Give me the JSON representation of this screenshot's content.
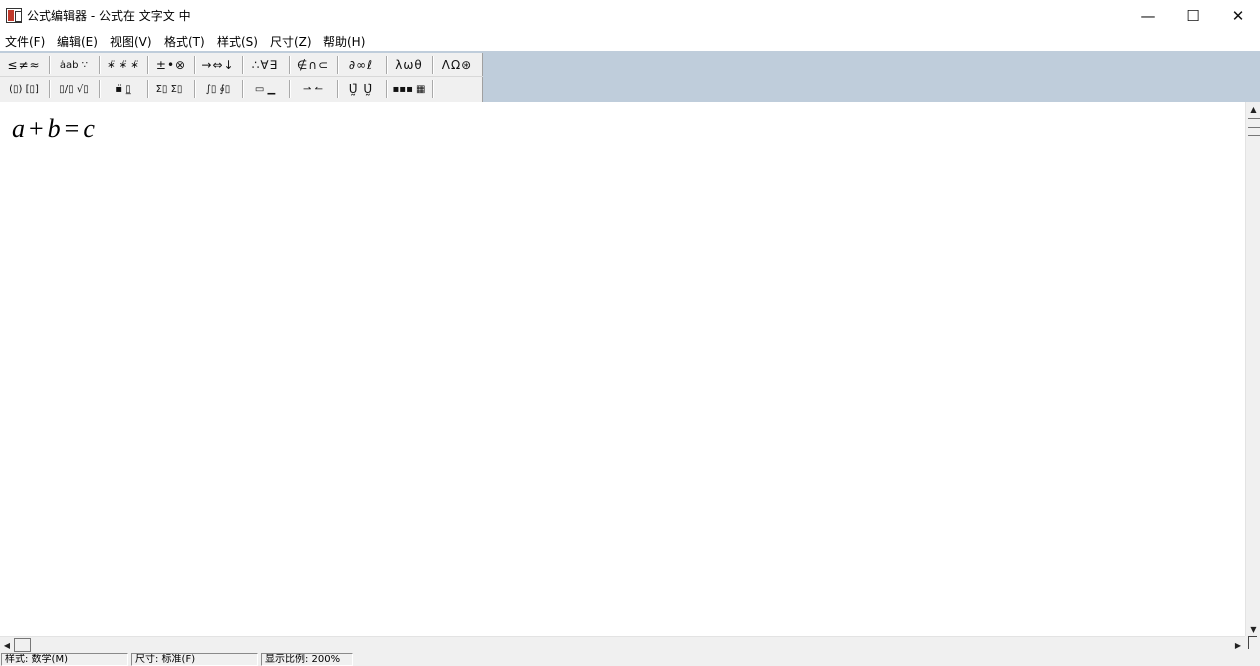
{
  "window": {
    "title": "公式编辑器 - 公式在 文字文 中",
    "minimize_glyph": "—",
    "maximize_glyph": "☐",
    "close_glyph": "✕",
    "icon": "equation-editor-icon"
  },
  "menu": [
    {
      "label": "文件(F)"
    },
    {
      "label": "编辑(E)"
    },
    {
      "label": "视图(V)"
    },
    {
      "label": "格式(T)"
    },
    {
      "label": "样式(S)"
    },
    {
      "label": "尺寸(Z)"
    },
    {
      "label": "帮助(H)"
    }
  ],
  "palette": {
    "row1": [
      {
        "label": "≤≠≈",
        "icon": "relational-symbols-icon"
      },
      {
        "label": "ȧab ∵",
        "icon": "spaces-ellipses-icon"
      },
      {
        "label": "∗̈ ∗̈ ∗̈",
        "icon": "embellishments-icon"
      },
      {
        "label": "±•⊗",
        "icon": "operator-symbols-icon"
      },
      {
        "label": "→⇔↓",
        "icon": "arrow-symbols-icon"
      },
      {
        "label": "∴∀∃",
        "icon": "logical-symbols-icon"
      },
      {
        "label": "∉∩⊂",
        "icon": "set-theory-symbols-icon"
      },
      {
        "label": "∂∞ℓ",
        "icon": "misc-symbols-icon"
      },
      {
        "label": "λωθ",
        "icon": "greek-lowercase-icon"
      },
      {
        "label": "ΛΩ⊛",
        "icon": "greek-uppercase-icon"
      }
    ],
    "row2": [
      {
        "label": "(▯) [▯]",
        "icon": "fence-templates-icon"
      },
      {
        "label": "▯/▯ √▯",
        "icon": "fraction-radical-templates-icon"
      },
      {
        "label": "▪̈ ▯̲",
        "icon": "subscript-superscript-templates-icon"
      },
      {
        "label": "Σ▯ Σ▯",
        "icon": "summation-templates-icon"
      },
      {
        "label": "∫▯ ∮▯",
        "icon": "integral-templates-icon"
      },
      {
        "label": "▭ ▁",
        "icon": "underbar-overbar-templates-icon"
      },
      {
        "label": "⇀ ↼",
        "icon": "labeled-arrow-templates-icon"
      },
      {
        "label": "Ṵ̄ Ṵ̇",
        "icon": "products-set-theory-templates-icon"
      },
      {
        "label": "▪▪▪ ▦",
        "icon": "matrix-templates-icon"
      }
    ]
  },
  "formula": {
    "a": "a",
    "plus": "+",
    "b": "b",
    "equals": "=",
    "c": "c"
  },
  "status": {
    "style": "样式: 数学(M)",
    "size": "尺寸: 标准(F)",
    "zoom": "显示比例: 200%"
  }
}
